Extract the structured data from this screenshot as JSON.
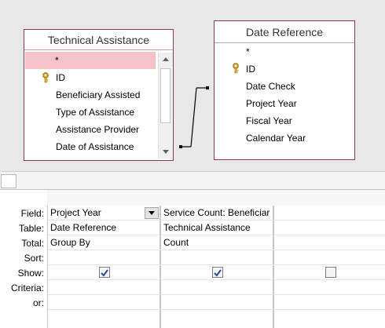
{
  "tables": [
    {
      "title": "Technical Assistance",
      "fields": [
        "*",
        "ID",
        "Beneficiary Assisted",
        "Type of Assistance",
        "Assistance Provider",
        "Date of Assistance"
      ]
    },
    {
      "title": "Date Reference",
      "fields": [
        "*",
        "ID",
        "Date Check",
        "Project Year",
        "Fiscal Year",
        "Calendar Year"
      ]
    }
  ],
  "grid": {
    "row_labels": [
      "Field:",
      "Table:",
      "Total:",
      "Sort:",
      "Show:",
      "Criteria:",
      "or:"
    ],
    "columns": [
      {
        "field": "Project Year",
        "table": "Date Reference",
        "total": "Group By",
        "sort": "",
        "show": true
      },
      {
        "field": "Service Count: Beneficiar",
        "table": "Technical Assistance",
        "total": "Count",
        "sort": "",
        "show": true
      },
      {
        "field": "",
        "table": "",
        "total": "",
        "sort": "",
        "show": false
      }
    ]
  },
  "colors": {
    "table_border": "#8b3a42",
    "selected_row": "#f5c2c7",
    "pane_bg": "#e8e8e8"
  },
  "icons": [
    "primary-key-icon",
    "scroll-up-arrow-icon",
    "scroll-down-arrow-icon",
    "dropdown-arrow-icon",
    "checkmark-icon"
  ]
}
